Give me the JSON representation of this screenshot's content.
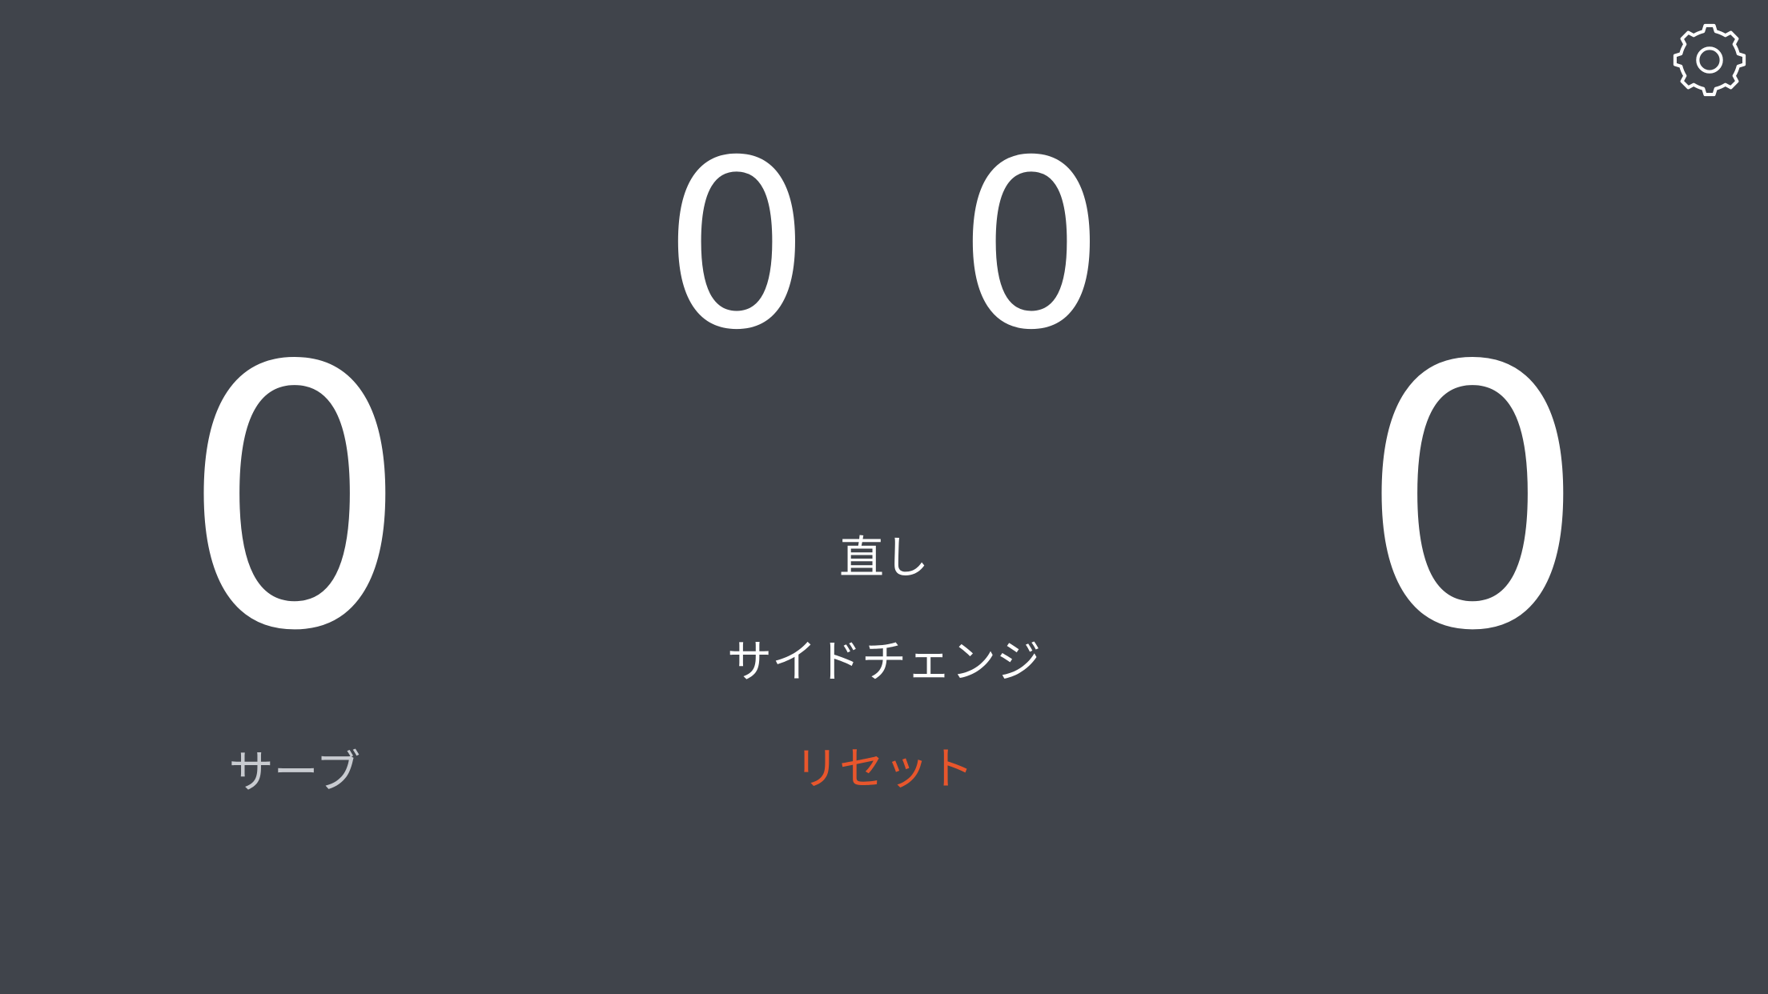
{
  "colors": {
    "background": "#40444b",
    "text": "#ffffff",
    "reset": "#e8562c",
    "serve": "#c8cbd0"
  },
  "header": {
    "settings_icon": "gear-icon"
  },
  "sets": {
    "left": "0",
    "right": "0"
  },
  "points": {
    "left": "0",
    "right": "0"
  },
  "actions": {
    "undo_label": "直し",
    "side_change_label": "サイドチェンジ",
    "reset_label": "リセット"
  },
  "serve": {
    "label": "サーブ"
  }
}
